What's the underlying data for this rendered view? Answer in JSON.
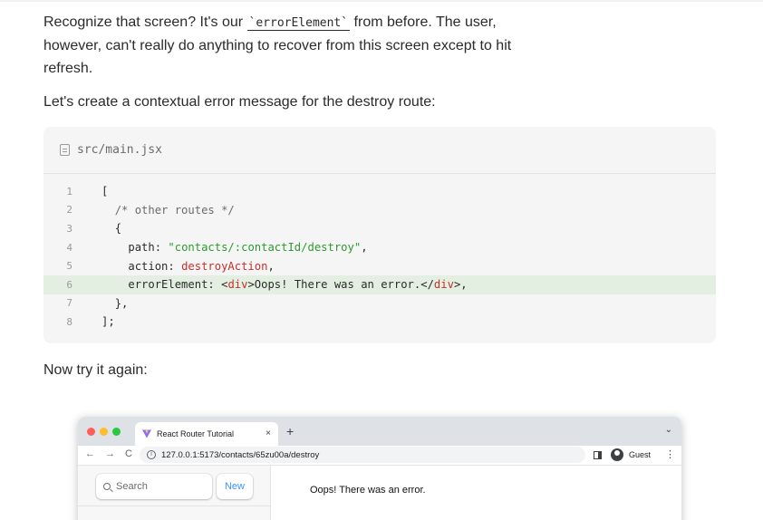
{
  "intro": {
    "before_code": "Recognize that screen? It's our ",
    "inline_code": "`errorElement`",
    "after_code": " from before. The user, however, can't really do anything to recover from this screen except to hit refresh."
  },
  "paragraph2": "Let's create a contextual error message for the destroy route:",
  "code_block": {
    "filename": "src/main.jsx",
    "line_numbers": [
      "1",
      "2",
      "3",
      "4",
      "5",
      "6",
      "7",
      "8"
    ],
    "l1": "[",
    "l2_comment": "/* other routes */",
    "l3": "{",
    "l4_key": "path: ",
    "l4_str": "\"contacts/:contactId/destroy\"",
    "l4_end": ",",
    "l5_key": "action: ",
    "l5_val": "destroyAction",
    "l5_end": ",",
    "l6_key": "errorElement: ",
    "l6_open_lt": "<",
    "l6_open_tag": "div",
    "l6_open_gt": ">",
    "l6_text": "Oops! There was an error.",
    "l6_close_lt": "</",
    "l6_close_tag": "div",
    "l6_close_gt": ">,",
    "l7": "},",
    "l8": "];"
  },
  "paragraph3": "Now try it again:",
  "browser": {
    "tab_title": "React Router Tutorial",
    "tab_close": "×",
    "new_tab": "+",
    "tab_menu": "⌄",
    "back": "←",
    "forward": "→",
    "reload": "C",
    "info": "i",
    "url": "127.0.0.1:5173/contacts/65zu00a/destroy",
    "profile_label": "Guest",
    "menu": "⋮",
    "search_placeholder": "Search",
    "new_button": "New",
    "error_message": "Oops! There was an error."
  },
  "colors": {
    "code_bg": "#f5f5f5",
    "highlight": "#e3efe1",
    "string": "#2f9a2f",
    "keyword_red": "#c9302c",
    "link_blue": "#3992ff"
  }
}
